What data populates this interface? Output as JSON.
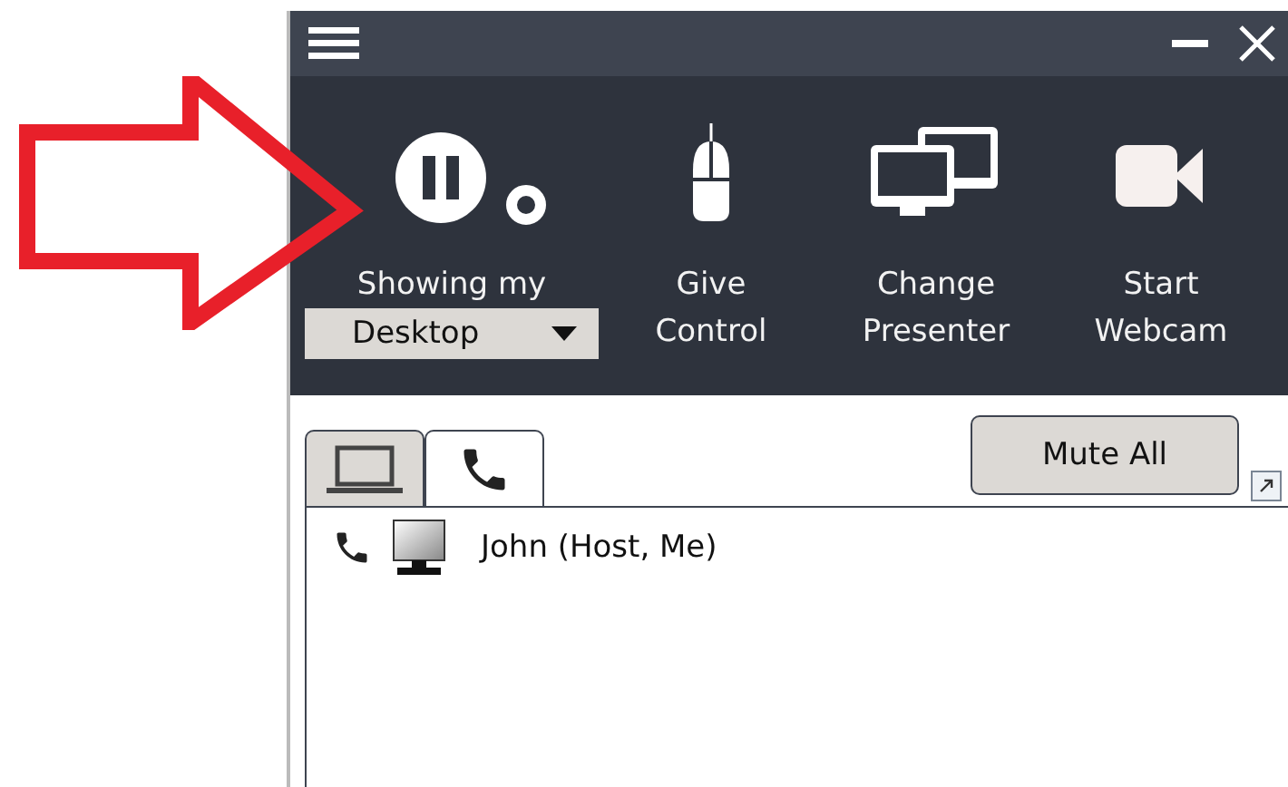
{
  "toolbar": {
    "items": [
      {
        "kind": "share",
        "label": "Showing my",
        "dropdown": "Desktop",
        "paused": true
      },
      {
        "kind": "mouse",
        "label": "Give\nControl"
      },
      {
        "kind": "monitors",
        "label": "Change\nPresenter"
      },
      {
        "kind": "webcam",
        "label": "Start\nWebcam"
      }
    ]
  },
  "tabs": [
    {
      "kind": "laptop",
      "selected": false
    },
    {
      "kind": "phone",
      "selected": true
    }
  ],
  "mute_button": "Mute All",
  "participants": [
    {
      "name": "John (Host, Me)",
      "phone": true,
      "screen": true
    }
  ]
}
